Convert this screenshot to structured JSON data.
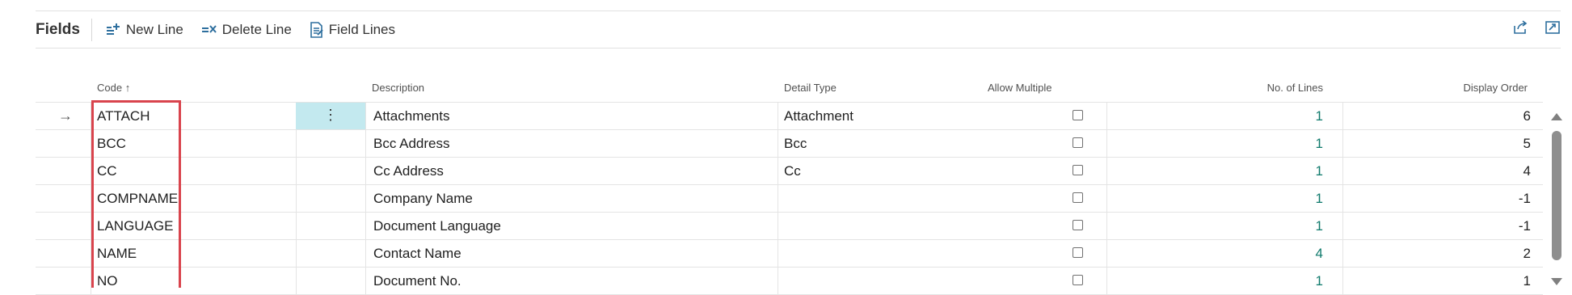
{
  "toolbar": {
    "title": "Fields",
    "new_line": "New Line",
    "delete_line": "Delete Line",
    "field_lines": "Field Lines"
  },
  "columns": {
    "code": "Code",
    "description": "Description",
    "detail_type": "Detail Type",
    "allow_multiple": "Allow Multiple",
    "no_of_lines": "No. of Lines",
    "display_order": "Display Order"
  },
  "rows": [
    {
      "code": "ATTACH",
      "description": "Attachments",
      "detail_type": "Attachment",
      "allow_multiple": false,
      "no_of_lines": "1",
      "display_order": "6"
    },
    {
      "code": "BCC",
      "description": "Bcc Address",
      "detail_type": "Bcc",
      "allow_multiple": false,
      "no_of_lines": "1",
      "display_order": "5"
    },
    {
      "code": "CC",
      "description": "Cc Address",
      "detail_type": "Cc",
      "allow_multiple": false,
      "no_of_lines": "1",
      "display_order": "4"
    },
    {
      "code": "COMPNAME",
      "description": "Company Name",
      "detail_type": "",
      "allow_multiple": false,
      "no_of_lines": "1",
      "display_order": "-1"
    },
    {
      "code": "LANGUAGE",
      "description": "Document Language",
      "detail_type": "",
      "allow_multiple": false,
      "no_of_lines": "1",
      "display_order": "-1"
    },
    {
      "code": "NAME",
      "description": "Contact Name",
      "detail_type": "",
      "allow_multiple": false,
      "no_of_lines": "4",
      "display_order": "2"
    },
    {
      "code": "NO",
      "description": "Document No.",
      "detail_type": "",
      "allow_multiple": false,
      "no_of_lines": "1",
      "display_order": "1"
    }
  ],
  "row_menu_glyph": "⋮",
  "current_row_glyph": "→",
  "sort_glyph": "↑",
  "colors": {
    "highlight": "#c3e9ef",
    "link": "#0f7a6c",
    "annotation": "#d9444d"
  },
  "icons": [
    "new-line-icon",
    "delete-line-icon",
    "field-lines-icon",
    "share-icon",
    "expand-icon"
  ]
}
